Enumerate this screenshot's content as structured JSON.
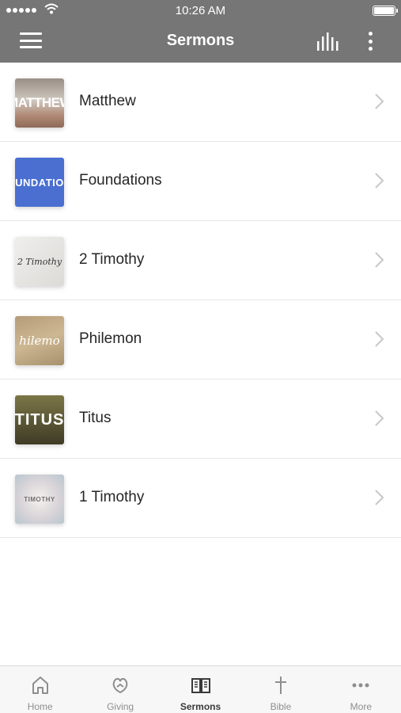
{
  "status_bar": {
    "time": "10:26 AM"
  },
  "nav": {
    "title": "Sermons",
    "menu_icon": "hamburger-menu-icon",
    "chart_icon": "audio-bars-icon",
    "more_icon": "more-vertical-icon"
  },
  "series": [
    {
      "title": "Matthew",
      "art_text": "MATTHEW"
    },
    {
      "title": "Foundations",
      "art_text": "UNDATIO"
    },
    {
      "title": "2 Timothy",
      "art_text": "2 Timothy"
    },
    {
      "title": "Philemon",
      "art_text": "hilemo"
    },
    {
      "title": "Titus",
      "art_text": "TITUS"
    },
    {
      "title": "1 Timothy",
      "art_text": "TIMOTHY"
    }
  ],
  "tabs": [
    {
      "label": "Home",
      "icon": "home-icon"
    },
    {
      "label": "Giving",
      "icon": "giving-icon"
    },
    {
      "label": "Sermons",
      "icon": "book-icon"
    },
    {
      "label": "Bible",
      "icon": "cross-icon"
    },
    {
      "label": "More",
      "icon": "more-horizontal-icon"
    }
  ],
  "colors": {
    "header_bg": "#767676",
    "active_tab": "#3a3a3a",
    "inactive_tab": "#8e8e8e"
  }
}
